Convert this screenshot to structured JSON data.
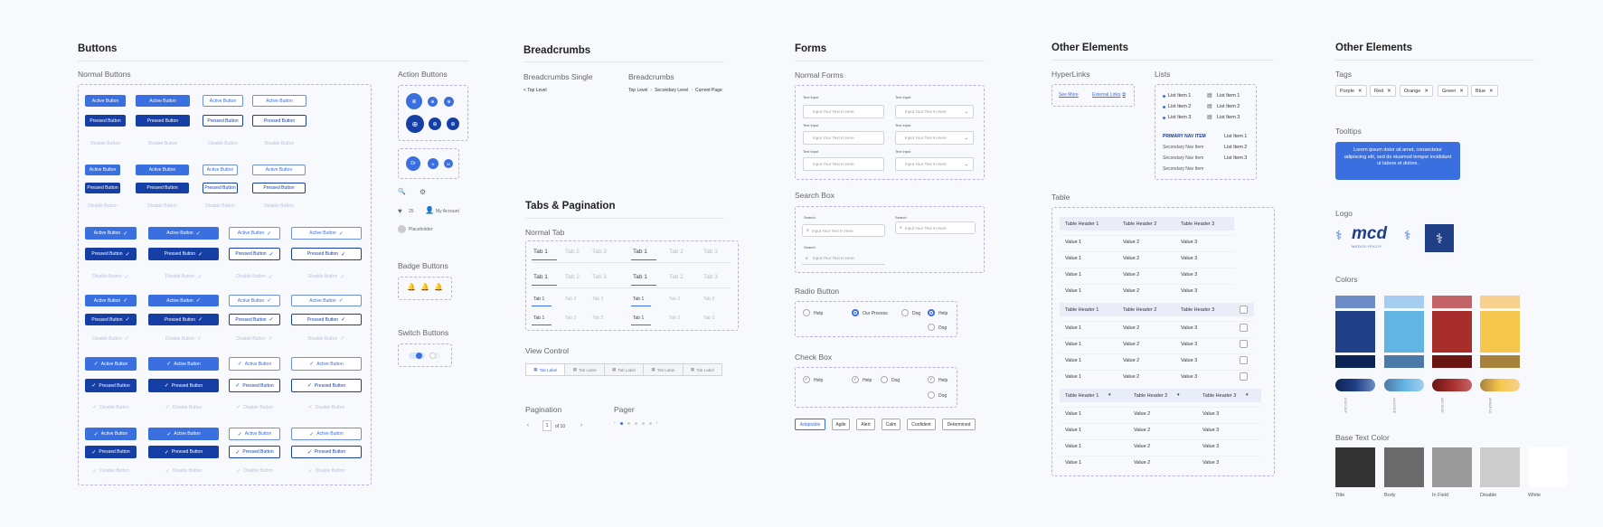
{
  "buttons": {
    "title": "Buttons",
    "normal_title": "Normal Buttons",
    "active": "Active Button",
    "pressed": "Pressed Button",
    "disabled": "Disable Button",
    "action_title": "Action Buttons",
    "badge_title": "Badge Buttons",
    "switch_title": "Switch Buttons",
    "avatar_1": "Dr",
    "avatar_2": "N",
    "avatar_3": "W",
    "likes": "25",
    "my_account": "My Account",
    "placeholder": "Placeholder"
  },
  "breadcrumbs": {
    "title": "Breadcrumbs",
    "single_title": "Breadcrumbs Single",
    "multi_title": "Breadcrumbs",
    "single": "< Top Level",
    "level1": "Top Level",
    "level2": "Secondary Level",
    "level3": "Current Page"
  },
  "tabs": {
    "title": "Tabs & Pagination",
    "normal_title": "Normal Tab",
    "tab1": "Tab 1",
    "tab2": "Tab 2",
    "tab3": "Tab 3",
    "view_title": "View Control",
    "tab_label": "Tab Label",
    "pagination_title": "Pagination",
    "page_current": "1",
    "page_of": "of 10",
    "pager_title": "Pager"
  },
  "forms": {
    "title": "Forms",
    "normal_title": "Normal Forms",
    "text_input": "Text Input",
    "placeholder": "Input Your Text In Here",
    "search_title": "Search Box",
    "search_label": "Search",
    "radio_title": "Radio Button",
    "help": "Help",
    "our_process": "Our Process",
    "dog": "Dog",
    "check_title": "Check Box",
    "chips": [
      "Adaptable",
      "Agile",
      "Alert",
      "Calm",
      "Confident",
      "Determined"
    ]
  },
  "other1": {
    "title": "Other Elements",
    "hyperlinks_title": "HyperLinks",
    "see_more": "See More",
    "external": "External Links",
    "lists_title": "Lists",
    "list_items": [
      "List Item 1",
      "List Item 2",
      "List Item 3"
    ],
    "primary_nav": "PRIMARY NAV ITEM",
    "secondary_nav": "Secondary Nav Item",
    "table_title": "Table",
    "headers": [
      "Table Header 1",
      "Table Header 2",
      "Table Header 3"
    ],
    "col1": "Value 1",
    "col2": "Value 2",
    "col3": "Value 3"
  },
  "other2": {
    "title": "Other Elements",
    "tags_title": "Tags",
    "tags": [
      "Purple",
      "Red",
      "Orange",
      "Green",
      "Blue"
    ],
    "tooltips_title": "Tooltips",
    "tooltip_text": "Lorem ipsum dolor sit amet, consectetur adipiscing elit, sed do eiusmod tempor incididunt ut labore et dolore.",
    "logo_title": "Logo",
    "logo_text": "mcd",
    "logo_sub": "MEDIDIYEKOY",
    "colors_title": "Colors",
    "colors": [
      "#6b8cc4",
      "#1f3f86",
      "#0c2454",
      "#a4cdef",
      "#62b4e2",
      "#4b7aa8",
      "#c46367",
      "#a82e2c",
      "#6a1512",
      "#f9d18e",
      "#f5c74c",
      "#a8823a"
    ],
    "color_codes": [
      "#3D72DF",
      "#4C83DE",
      "#B73E3E",
      "#E6AF2A"
    ],
    "base_text_title": "Base Text Color",
    "base_colors": [
      "#333333",
      "#6b6b6b",
      "#9a9a9a",
      "#cccccc",
      "#ffffff"
    ],
    "base_labels": [
      "Title",
      "Body",
      "In Field",
      "Disable",
      "White"
    ]
  }
}
